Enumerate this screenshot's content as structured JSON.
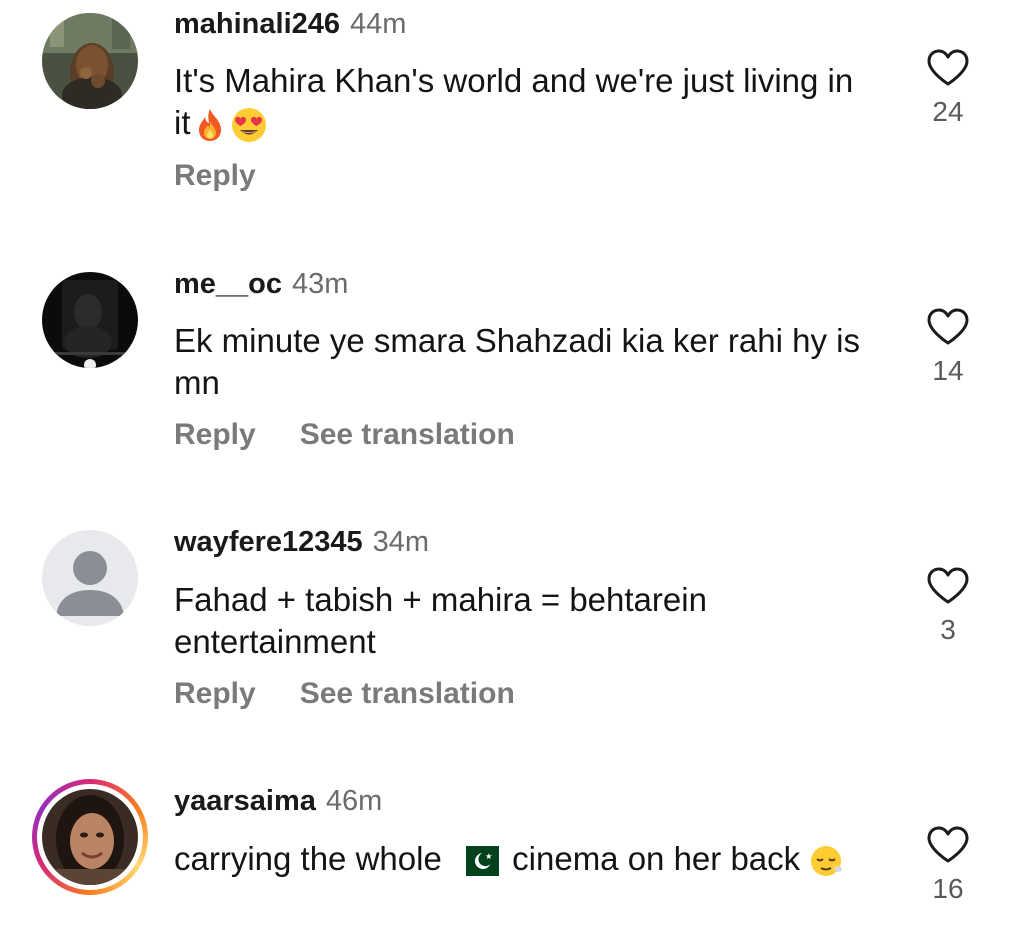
{
  "comments": [
    {
      "username": "mahinali246",
      "time": "44m",
      "text": "It's Mahira Khan's world and we're just living in it",
      "emojis": [
        "fire",
        "heart-eyes"
      ],
      "reply_label": "Reply",
      "likes": "24",
      "avatar": "profile-photo"
    },
    {
      "username": "me__oc",
      "time": "43m",
      "text": "Ek minute ye smara Shahzadi kia ker rahi hy is mn",
      "reply_label": "Reply",
      "translation_label": "See translation",
      "likes": "14",
      "avatar": "profile-photo-dark"
    },
    {
      "username": "wayfere12345",
      "time": "34m",
      "text": "Fahad + tabish + mahira = behtarein entertainment",
      "reply_label": "Reply",
      "translation_label": "See translation",
      "likes": "3",
      "avatar": "default-avatar"
    },
    {
      "username": "yaarsaima",
      "time": "46m",
      "text_before_flag": "carrying the whole",
      "text_after_flag": "cinema on her back",
      "flag": "pakistan-flag",
      "emojis": [
        "relieved-face"
      ],
      "likes": "16",
      "avatar": "profile-photo-story-ring"
    }
  ],
  "colors": {
    "username": "#1a1a1a",
    "time": "#6b6b6b",
    "action": "#7a7a7a",
    "like_count": "#5a5a5a",
    "heart_stroke": "#1c1c1c"
  }
}
